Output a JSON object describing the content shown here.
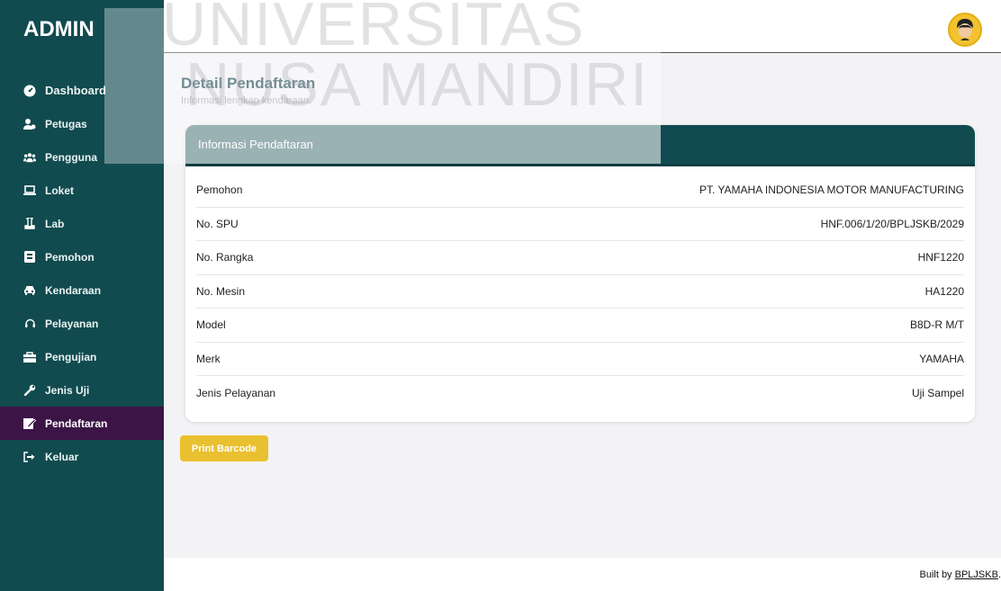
{
  "brand": "ADMIN",
  "sidebar": {
    "items": [
      {
        "label": "Dashboard",
        "icon": "dashboard-icon"
      },
      {
        "label": "Petugas",
        "icon": "user-tie-icon"
      },
      {
        "label": "Pengguna",
        "icon": "users-icon"
      },
      {
        "label": "Loket",
        "icon": "laptop-icon"
      },
      {
        "label": "Lab",
        "icon": "flask-icon"
      },
      {
        "label": "Pemohon",
        "icon": "id-card-icon"
      },
      {
        "label": "Kendaraan",
        "icon": "car-icon"
      },
      {
        "label": "Pelayanan",
        "icon": "headset-icon"
      },
      {
        "label": "Pengujian",
        "icon": "toolbox-icon"
      },
      {
        "label": "Jenis Uji",
        "icon": "wrench-icon"
      },
      {
        "label": "Pendaftaran",
        "icon": "pen-square-icon",
        "active": true
      },
      {
        "label": "Keluar",
        "icon": "sign-out-icon"
      }
    ]
  },
  "watermark": {
    "line1": "UNIVERSITAS",
    "line2": "NUSA MANDIRI"
  },
  "page": {
    "title": "Detail Pendaftaran",
    "subtitle": "Informasi lengkap kendaraan."
  },
  "card": {
    "header": "Informasi Pendaftaran",
    "rows": [
      {
        "label": "Pemohon",
        "value": "PT. YAMAHA INDONESIA MOTOR MANUFACTURING"
      },
      {
        "label": "No. SPU",
        "value": "HNF.006/1/20/BPLJSKB/2029"
      },
      {
        "label": "No. Rangka",
        "value": "HNF1220"
      },
      {
        "label": "No. Mesin",
        "value": "HA1220"
      },
      {
        "label": "Model",
        "value": "B8D-R M/T"
      },
      {
        "label": "Merk",
        "value": "YAMAHA"
      },
      {
        "label": "Jenis Pelayanan",
        "value": "Uji Sampel"
      }
    ]
  },
  "actions": {
    "print_label": "Print Barcode"
  },
  "footer": {
    "text": "Built by ",
    "link": "BPLJSKB",
    "suffix": "."
  },
  "colors": {
    "sidebar": "#114b4f",
    "active_item": "#3c1446",
    "accent_button": "#e9c02f"
  }
}
